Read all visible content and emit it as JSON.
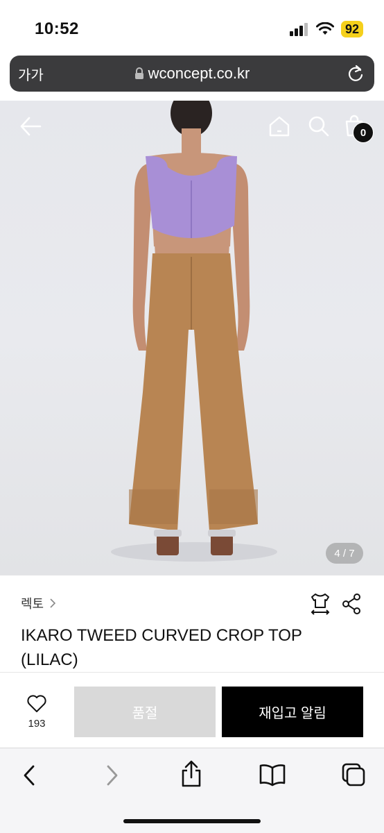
{
  "status_bar": {
    "time": "10:52",
    "battery": "92"
  },
  "browser": {
    "text_size_label": "가가",
    "url": "wconcept.co.kr"
  },
  "gallery": {
    "counter": "4 / 7",
    "cart_count": "0"
  },
  "product": {
    "brand": "렉토",
    "title": "IKARO TWEED CURVED CROP TOP (LILAC)"
  },
  "actions": {
    "wish_count": "193",
    "soldout_label": "품절",
    "restock_label": "재입고 알림"
  },
  "colors": {
    "top_lilac": "#a88fd6",
    "pants_tan": "#b88553",
    "soldout_gray": "#d9d9d9",
    "battery_yellow": "#f5d01c"
  }
}
